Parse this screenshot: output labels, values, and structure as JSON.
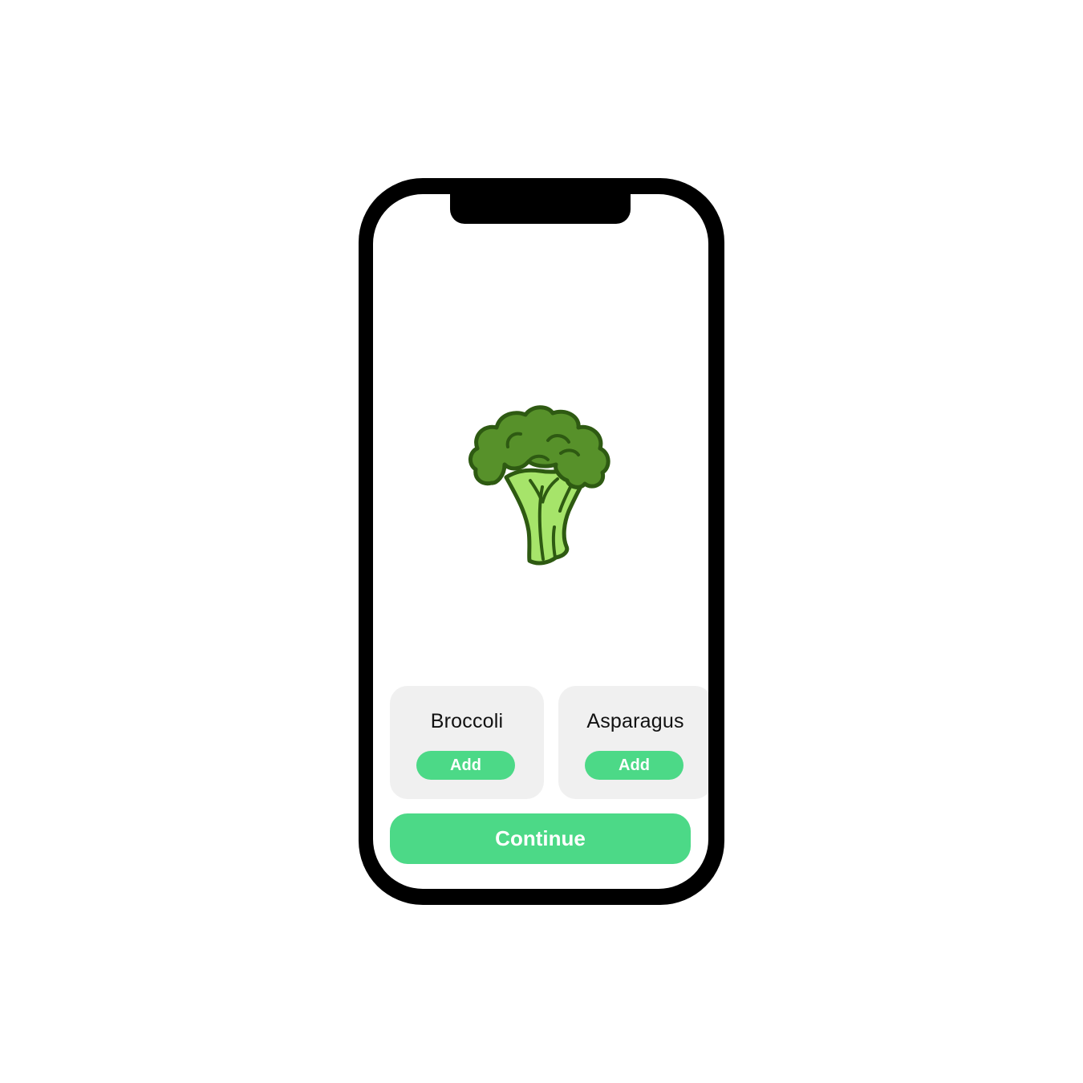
{
  "hero": {
    "icon": "broccoli-icon"
  },
  "cards": [
    {
      "title": "Broccoli",
      "add_label": "Add"
    },
    {
      "title": "Asparagus",
      "add_label": "Add"
    }
  ],
  "continue_label": "Continue",
  "colors": {
    "accent": "#4cd987",
    "card_bg": "#f0f0f0",
    "frame": "#000000"
  }
}
